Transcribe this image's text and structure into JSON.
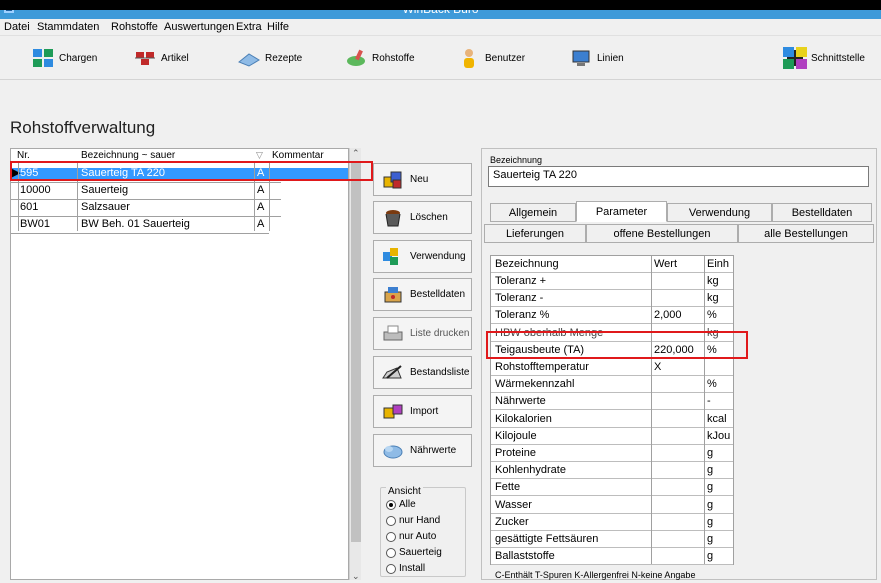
{
  "window": {
    "title": "WinBack Büro"
  },
  "menu": [
    "Datei",
    "Stammdaten",
    "Rohstoffe",
    "Auswertungen",
    "Extra",
    "Hilfe"
  ],
  "toolbar": [
    {
      "label": "Chargen",
      "icon": "chargen-icon"
    },
    {
      "label": "Artikel",
      "icon": "artikel-icon"
    },
    {
      "label": "Rezepte",
      "icon": "rezepte-icon"
    },
    {
      "label": "Rohstoffe",
      "icon": "rohstoffe-icon"
    },
    {
      "label": "Benutzer",
      "icon": "benutzer-icon"
    },
    {
      "label": "Linien",
      "icon": "linien-icon"
    },
    {
      "label": "Schnittstelle",
      "icon": "schnittstelle-icon"
    }
  ],
  "page": {
    "heading": "Rohstoffverwaltung"
  },
  "grid": {
    "columns": [
      "Nr.",
      "Bezeichnung ~ sauer",
      "",
      "Kommentar"
    ],
    "rows": [
      {
        "nr": "595",
        "bez": "Sauerteig TA 220",
        "flag": "A",
        "kommentar": "",
        "selected": true
      },
      {
        "nr": "10000",
        "bez": "Sauerteig",
        "flag": "A",
        "kommentar": ""
      },
      {
        "nr": "601",
        "bez": "Salzsauer",
        "flag": "A",
        "kommentar": ""
      },
      {
        "nr": "BW01",
        "bez": "BW Beh. 01 Sauerteig",
        "flag": "A",
        "kommentar": ""
      }
    ]
  },
  "actions": [
    {
      "label": "Neu",
      "icon": "neu-icon"
    },
    {
      "label": "Löschen",
      "icon": "loeschen-icon"
    },
    {
      "label": "Verwendung",
      "icon": "verwendung-icon"
    },
    {
      "label": "Bestelldaten",
      "icon": "bestelldaten-icon"
    },
    {
      "label": "Liste drucken",
      "icon": "drucken-icon"
    },
    {
      "label": "Bestandsliste",
      "icon": "bestandsliste-icon"
    },
    {
      "label": "Import",
      "icon": "import-icon"
    },
    {
      "label": "Nährwerte",
      "icon": "naehrwerte-icon"
    }
  ],
  "ansicht": {
    "label": "Ansicht",
    "options": [
      "Alle",
      "nur Hand",
      "nur Auto",
      "Sauerteig",
      "Install"
    ],
    "selected": "Alle"
  },
  "detail": {
    "bez_label": "Bezeichnung",
    "bez_value": "Sauerteig TA 220",
    "tabs_row1": [
      "Allgemein",
      "Parameter",
      "Verwendung",
      "Bestelldaten"
    ],
    "tabs_row2": [
      "Lieferungen",
      "offene Bestellungen",
      "alle Bestellungen"
    ],
    "active_tab": "Parameter",
    "param_headers": [
      "Bezeichnung",
      "Wert",
      "Einh"
    ],
    "params": [
      {
        "name": "Toleranz +",
        "wert": "",
        "einh": "kg"
      },
      {
        "name": "Toleranz -",
        "wert": "",
        "einh": "kg"
      },
      {
        "name": "Toleranz %",
        "wert": "2,000",
        "einh": "%"
      },
      {
        "name": "HBW oberhalb Menge",
        "wert": "",
        "einh": "kg",
        "struck": true
      },
      {
        "name": "Teigausbeute (TA)",
        "wert": "220,000",
        "einh": "%"
      },
      {
        "name": "Rohstofftemperatur",
        "wert": "X",
        "einh": ""
      },
      {
        "name": "Wärmekennzahl",
        "wert": "",
        "einh": "%"
      },
      {
        "name": "Nährwerte",
        "wert": "",
        "einh": "-"
      },
      {
        "name": "Kilokalorien",
        "wert": "",
        "einh": "kcal"
      },
      {
        "name": "Kilojoule",
        "wert": "",
        "einh": "kJou"
      },
      {
        "name": "Proteine",
        "wert": "",
        "einh": "g"
      },
      {
        "name": "Kohlenhydrate",
        "wert": "",
        "einh": "g"
      },
      {
        "name": "Fette",
        "wert": "",
        "einh": "g"
      },
      {
        "name": "Wasser",
        "wert": "",
        "einh": "g"
      },
      {
        "name": "Zucker",
        "wert": "",
        "einh": "g"
      },
      {
        "name": "gesättigte Fettsäuren",
        "wert": "",
        "einh": "g"
      },
      {
        "name": "Ballaststoffe",
        "wert": "",
        "einh": "g"
      }
    ],
    "footer": "C-Enthält T-Spuren K-Allergenfrei N-keine Angabe"
  },
  "colors": {
    "selection": "#3399ff",
    "highlight": "#e0191b",
    "titlebar": "#3e9ad9"
  }
}
